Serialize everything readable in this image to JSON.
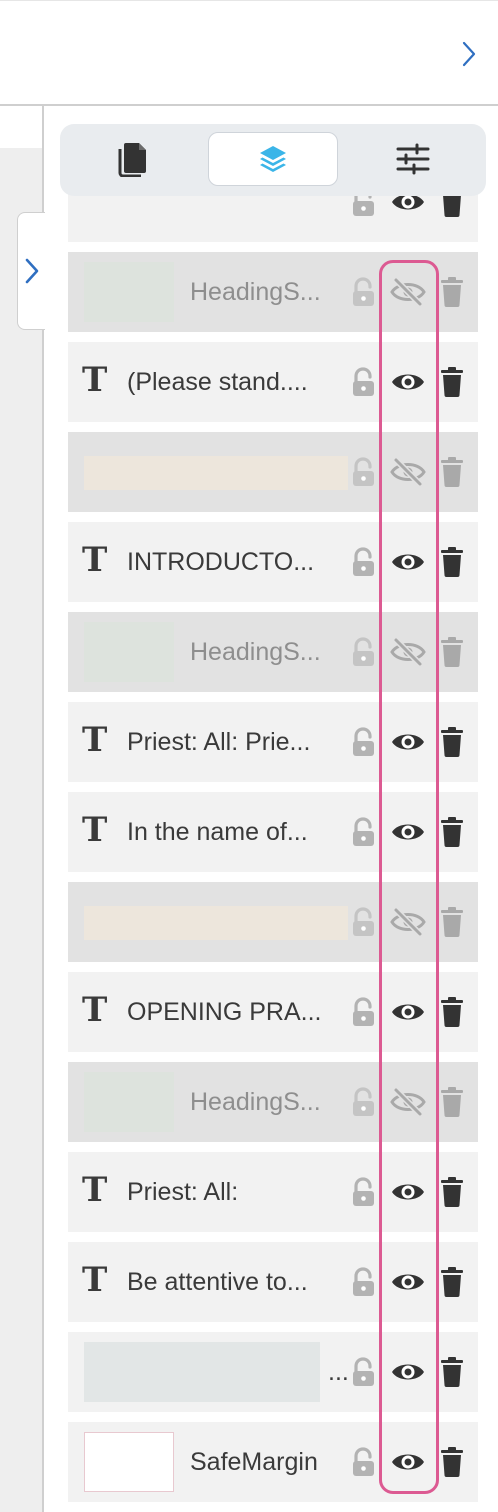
{
  "colors": {
    "accent": "#2f6fc1",
    "layers_accent": "#3bb5e8",
    "highlight": "#dc5a92",
    "icon_dark": "#333333",
    "icon_muted": "#b7b7b7"
  },
  "topbar": {
    "collapse_icon": "chevron-right-icon"
  },
  "panel_toggle": {
    "icon": "chevron-right-icon"
  },
  "tabs": [
    {
      "name": "pages",
      "icon": "pages-icon",
      "active": false
    },
    {
      "name": "layers",
      "icon": "layers-icon",
      "active": true
    },
    {
      "name": "settings",
      "icon": "sliders-icon",
      "active": false
    }
  ],
  "layers": [
    {
      "type": "partial",
      "label": "",
      "visible": true
    },
    {
      "type": "thumb",
      "label": "HeadingS...",
      "visible": false,
      "thumb_color": "#dde3dd"
    },
    {
      "type": "text",
      "label": "(Please stand....",
      "visible": true
    },
    {
      "type": "thumb-wide",
      "label": "",
      "visible": false,
      "thumb_color": "#ede6dc"
    },
    {
      "type": "text",
      "label": "INTRODUCTO...",
      "visible": true
    },
    {
      "type": "thumb",
      "label": "HeadingS...",
      "visible": false,
      "thumb_color": "#dde3dd"
    },
    {
      "type": "text",
      "label": "Priest: All: Prie...",
      "visible": true
    },
    {
      "type": "text",
      "label": "In the name of...",
      "visible": true
    },
    {
      "type": "thumb-wide",
      "label": "",
      "visible": false,
      "thumb_color": "#ede6dc"
    },
    {
      "type": "text",
      "label": "OPENING PRA...",
      "visible": true
    },
    {
      "type": "thumb",
      "label": "HeadingS...",
      "visible": false,
      "thumb_color": "#dde3dd"
    },
    {
      "type": "text",
      "label": "Priest: All:",
      "visible": true
    },
    {
      "type": "text",
      "label": "Be attentive to...",
      "visible": true
    },
    {
      "type": "thumb-ellipsis",
      "label": "...",
      "visible": true,
      "thumb_color": "#e2e6e6"
    },
    {
      "type": "thumb-outline",
      "label": "SafeMargin",
      "visible": true,
      "thumb_color": "#ffffff"
    }
  ]
}
